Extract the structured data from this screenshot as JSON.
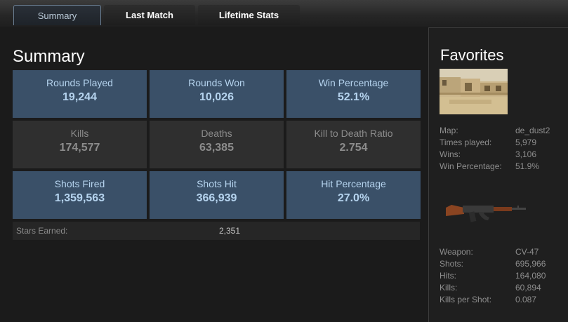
{
  "tabs": [
    {
      "label": "Summary",
      "active": true
    },
    {
      "label": "Last Match",
      "active": false
    },
    {
      "label": "Lifetime Stats",
      "active": false
    }
  ],
  "summary": {
    "title": "Summary",
    "cells": [
      {
        "label": "Rounds Played",
        "value": "19,244",
        "style": "blue"
      },
      {
        "label": "Rounds Won",
        "value": "10,026",
        "style": "blue"
      },
      {
        "label": "Win Percentage",
        "value": "52.1%",
        "style": "blue"
      },
      {
        "label": "Kills",
        "value": "174,577",
        "style": "gray"
      },
      {
        "label": "Deaths",
        "value": "63,385",
        "style": "gray"
      },
      {
        "label": "Kill to Death Ratio",
        "value": "2.754",
        "style": "gray"
      },
      {
        "label": "Shots Fired",
        "value": "1,359,563",
        "style": "blue"
      },
      {
        "label": "Shots Hit",
        "value": "366,939",
        "style": "blue"
      },
      {
        "label": "Hit Percentage",
        "value": "27.0%",
        "style": "blue"
      }
    ],
    "stars": {
      "label": "Stars Earned:",
      "value": "2,351"
    }
  },
  "favorites": {
    "title": "Favorites",
    "map": {
      "image_icon": "map-thumbnail",
      "rows": [
        {
          "key": "Map:",
          "value": "de_dust2"
        },
        {
          "key": "Times played:",
          "value": "5,979"
        },
        {
          "key": "Wins:",
          "value": "3,106"
        },
        {
          "key": "Win Percentage:",
          "value": "51.9%"
        }
      ]
    },
    "weapon": {
      "image_icon": "rifle-icon",
      "rows": [
        {
          "key": "Weapon:",
          "value": "CV-47"
        },
        {
          "key": "Shots:",
          "value": "695,966"
        },
        {
          "key": "Hits:",
          "value": "164,080"
        },
        {
          "key": "Kills:",
          "value": "60,894"
        },
        {
          "key": "Kills per Shot:",
          "value": "0.087"
        }
      ]
    }
  },
  "colors": {
    "blue_cell": "#3a5068",
    "gray_cell": "#2f2f2f",
    "blue_text": "#b5d3ee",
    "active_tab_border": "#6b7f93"
  }
}
